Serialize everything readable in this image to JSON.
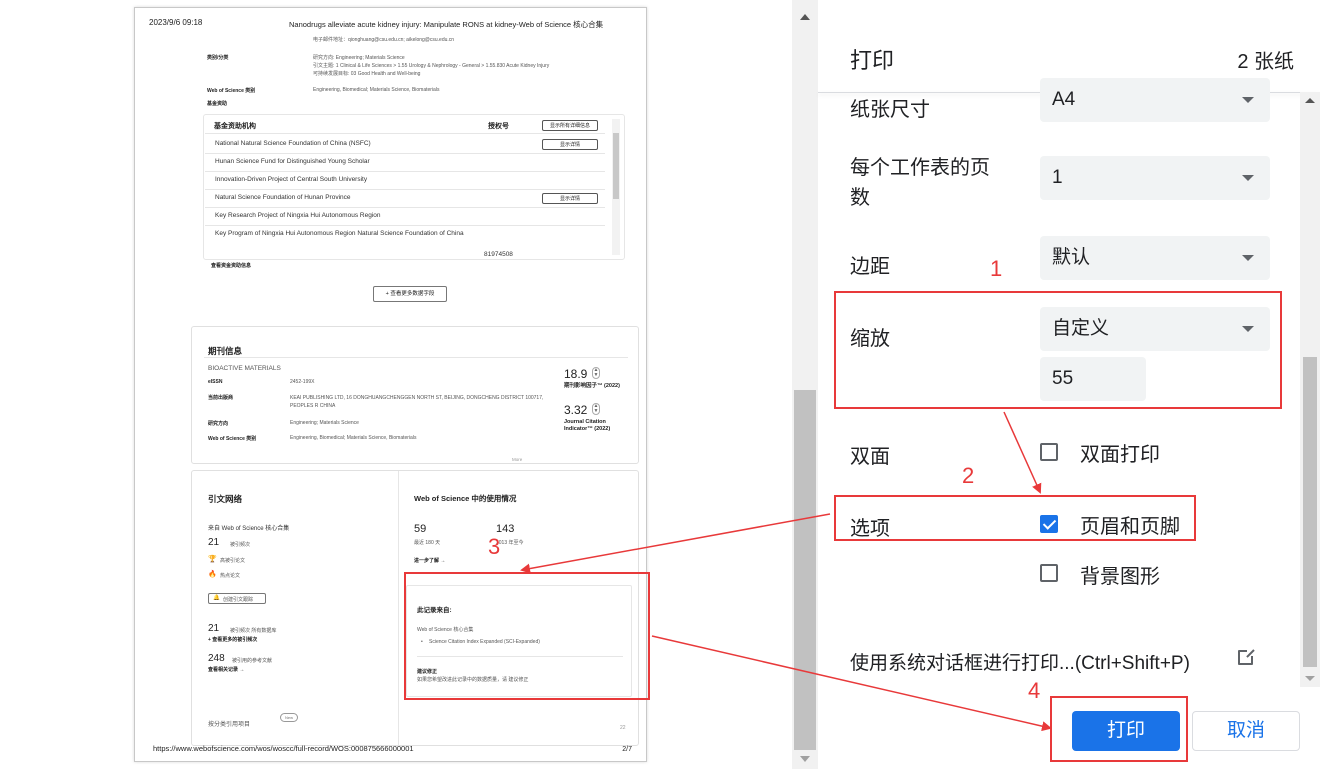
{
  "preview": {
    "header_date": "2023/9/6 09:18",
    "header_title": "Nanodrugs alleviate acute kidney injury: Manipulate RONS at kidney-Web of Science 核心合集",
    "footer_url": "https://www.webofscience.com/wos/woscc/full-record/WOS:000875666000001",
    "footer_page": "2/7",
    "email_line": "电子邮件地址：qionghuang@csu.edu.cn; aikelong@csu.edu.cn",
    "category_label": "类别/分类",
    "research_area": "研究方向: Engineering; Materials Science",
    "citation_topic": "引文主题: 1 Clinical & Life Sciences > 1.55 Urology & Nephrology - General > 1.55.830 Acute Kidney Injury",
    "sdg": "可持续发展目标: 03 Good Health and Well-being",
    "wos_category_label": "Web of Science 类别",
    "wos_category_value": "Engineering, Biomedical; Materials Science, Biomaterials",
    "funding_label": "基金资助",
    "funding_table": {
      "col_agency": "基金资助机构",
      "col_grant": "授权号",
      "show_all_btn": "显示所有详细信息",
      "show_detail_btn": "显示详情",
      "rows": [
        "National Natural Science Foundation of China (NSFC)",
        "Hunan Science Fund for Distinguished Young Scholar",
        "Innovation-Driven Project of Central South University",
        "Natural Science Foundation of Hunan Province",
        "Key Research Project of Ningxia Hui Autonomous Region",
        "Key Program of Ningxia Hui Autonomous Region Natural Science Foundation of China"
      ],
      "grant_number": "81974508"
    },
    "view_funding": "查看资金资助信息",
    "view_more_fields": "+ 查看更多数据字段",
    "journal": {
      "section_title": "期刊信息",
      "name": "BIOACTIVE MATERIALS",
      "eissn_label": "eISSN",
      "eissn_value": "2452-199X",
      "publisher_label": "当前出版商",
      "publisher_value": "KEAI PUBLISHING LTD, 16 DONGHUANGCHENGGEN NORTH ST, BEIJING, DONGCHENG DISTRICT 100717, PEOPLES R CHINA",
      "research_label": "研究方向",
      "research_value": "Engineering; Materials Science",
      "wos_cat_label": "Web of Science 类别",
      "wos_cat_value": "Engineering, Biomedical; Materials Science, Biomaterials",
      "if_value": "18.9",
      "if_label": "期刊影响因子™ (2022)",
      "jci_value": "3.32",
      "jci_label": "Journal Citation Indicator™ (2022)",
      "more": "More"
    },
    "citation_network": {
      "title": "引文网络",
      "from_label": "来自 Web of Science 核心合集",
      "times_cited_num": "21",
      "times_cited_label": "被引频次",
      "highly_cited": "高被引论文",
      "hot_paper": "热点论文",
      "create_alert": "创建引文跟踪",
      "all_db_num": "21",
      "all_db_label": "被引频次 所有数据库",
      "see_more_times": "+ 查看更多的被引频次",
      "refs_num": "248",
      "refs_label": "被引用的参考文献",
      "see_related": "查看相关记录 →",
      "classify_label": "按分类引用项目",
      "new_badge": "New"
    },
    "usage": {
      "title": "Web of Science 中的使用情况",
      "count_180": "59",
      "label_180": "最近 180 天",
      "count_2013": "143",
      "label_2013": "2013 年至今",
      "learn_more": "进一步了解 →"
    },
    "record_from": {
      "title": "此记录来自:",
      "source": "Web of Science 核心合集",
      "index": "Science Citation Index Expanded (SCI-Expanded)",
      "suggest_title": "建议修正",
      "suggest_text": "如果您希望改进此记录中的数据质量，请 建议修正"
    },
    "page_counter": "22"
  },
  "annotations": {
    "num1": "1",
    "num2": "2",
    "num3": "3",
    "num4": "4",
    "color": "#e8393a"
  },
  "panel": {
    "title": "打印",
    "sheets": "2 张纸",
    "paper_size_label": "纸张尺寸",
    "paper_size_value": "A4",
    "pages_per_sheet_label_1": "每个工作表的页",
    "pages_per_sheet_label_2": "数",
    "pages_per_sheet_value": "1",
    "margins_label": "边距",
    "margins_value": "默认",
    "scale_label": "缩放",
    "scale_value": "自定义",
    "scale_number": "55",
    "duplex_label": "双面",
    "duplex_option": "双面打印",
    "options_label": "选项",
    "headers_footers": "页眉和页脚",
    "background_graphics": "背景图形",
    "system_dialog": "使用系统对话框进行打印...(Ctrl+Shift+P)",
    "print_button": "打印",
    "cancel_button": "取消",
    "accent_color": "#1a73e8"
  }
}
